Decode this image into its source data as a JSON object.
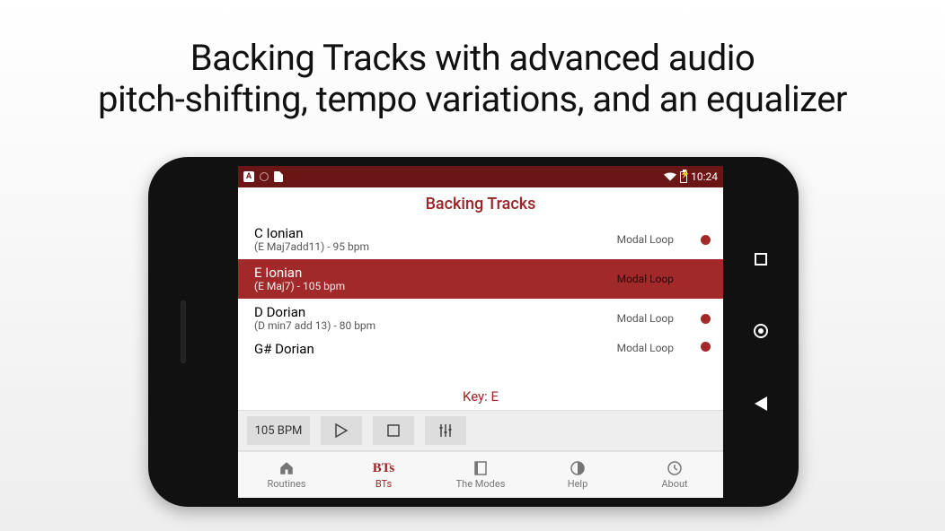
{
  "headline_line1": "Backing Tracks with advanced audio",
  "headline_line2": "pitch-shifting, tempo variations, and an equalizer",
  "statusbar": {
    "time": "10:24"
  },
  "header": {
    "title": "Backing Tracks"
  },
  "tracks": [
    {
      "title": "C Ionian",
      "sub": "(E Maj7add11) - 95 bpm",
      "tag": "Modal Loop",
      "selected": false
    },
    {
      "title": "E Ionian",
      "sub": "(E Maj7) - 105 bpm",
      "tag": "Modal Loop",
      "selected": true
    },
    {
      "title": "D Dorian",
      "sub": "(D min7 add 13) - 80 bpm",
      "tag": "Modal Loop",
      "selected": false
    },
    {
      "title": "G# Dorian",
      "sub": "",
      "tag": "Modal Loop",
      "selected": false
    }
  ],
  "key_label": "Key: E",
  "controls": {
    "bpm": "105 BPM"
  },
  "tabs": [
    {
      "id": "routines",
      "label": "Routines"
    },
    {
      "id": "bts",
      "label": "BTs",
      "glyph": "BTs"
    },
    {
      "id": "modes",
      "label": "The Modes"
    },
    {
      "id": "help",
      "label": "Help"
    },
    {
      "id": "about",
      "label": "About"
    }
  ],
  "active_tab": "bts"
}
